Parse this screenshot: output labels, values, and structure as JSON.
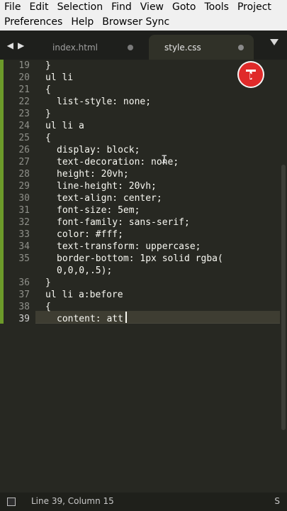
{
  "menu": {
    "row1": [
      "File",
      "Edit",
      "Selection",
      "Find",
      "View",
      "Goto",
      "Tools",
      "Project"
    ],
    "row2": [
      "Preferences",
      "Help",
      "Browser Sync"
    ]
  },
  "tabs": [
    {
      "label": "index.html"
    },
    {
      "label": "style.css"
    }
  ],
  "editor": {
    "lines": [
      {
        "no": "19",
        "text": "}",
        "indent": false
      },
      {
        "no": "20",
        "text": "ul li",
        "indent": false
      },
      {
        "no": "21",
        "text": "{",
        "indent": false
      },
      {
        "no": "22",
        "text": "list-style: none;",
        "indent": true
      },
      {
        "no": "23",
        "text": "}",
        "indent": false
      },
      {
        "no": "24",
        "text": "ul li a",
        "indent": false
      },
      {
        "no": "25",
        "text": "{",
        "indent": false
      },
      {
        "no": "26",
        "text": "display: block;",
        "indent": true
      },
      {
        "no": "27",
        "text": "text-decoration: none;",
        "indent": true
      },
      {
        "no": "28",
        "text": "height: 20vh;",
        "indent": true
      },
      {
        "no": "29",
        "text": "line-height: 20vh;",
        "indent": true
      },
      {
        "no": "30",
        "text": "text-align: center;",
        "indent": true
      },
      {
        "no": "31",
        "text": "font-size: 5em;",
        "indent": true
      },
      {
        "no": "32",
        "text": "font-family: sans-serif;",
        "indent": true
      },
      {
        "no": "33",
        "text": "color: #fff;",
        "indent": true
      },
      {
        "no": "34",
        "text": "text-transform: uppercase;",
        "indent": true
      },
      {
        "no": "35",
        "text": "border-bottom: 1px solid rgba(",
        "indent": true
      },
      {
        "no": "",
        "text": "0,0,0,.5);",
        "indent": true
      },
      {
        "no": "36",
        "text": "}",
        "indent": false
      },
      {
        "no": "37",
        "text": "ul li a:before",
        "indent": false
      },
      {
        "no": "38",
        "text": "{",
        "indent": false
      },
      {
        "no": "39",
        "text": "content: att",
        "indent": true
      }
    ],
    "active_line": "39"
  },
  "status": {
    "position": "Line 39, Column 15",
    "syntax": "S"
  },
  "colors": {
    "editor_bg": "#272822",
    "text": "#f8f8f2",
    "gutter_accent": "#6c9a2a",
    "logo": "#e02a2a"
  }
}
